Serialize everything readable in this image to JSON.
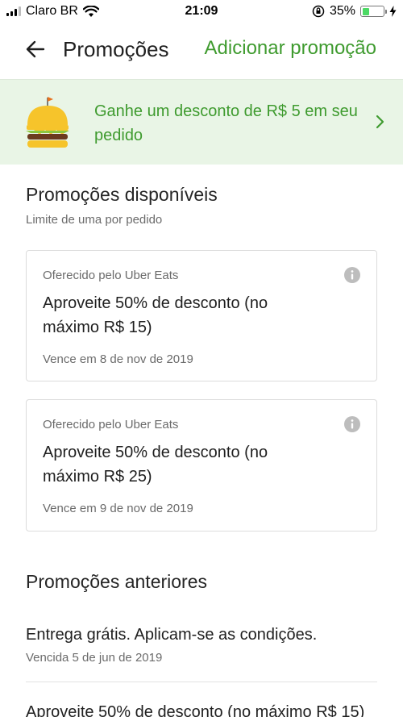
{
  "status_bar": {
    "carrier": "Claro BR",
    "time": "21:09",
    "battery": "35%",
    "battery_level": 0.35
  },
  "header": {
    "title": "Promoções",
    "add_promo": "Adicionar promoção"
  },
  "banner": {
    "text": "Ganhe um desconto de R$ 5 em seu pedido"
  },
  "available": {
    "title": "Promoções disponíveis",
    "subtitle": "Limite de uma por pedido",
    "cards": [
      {
        "offered_by": "Oferecido pelo Uber Eats",
        "title": "Aproveite 50% de desconto (no máximo R$ 15)",
        "expiry": "Vence em 8 de nov de 2019"
      },
      {
        "offered_by": "Oferecido pelo Uber Eats",
        "title": "Aproveite 50% de desconto (no máximo R$ 25)",
        "expiry": "Vence em 9 de nov de 2019"
      }
    ]
  },
  "previous": {
    "title": "Promoções anteriores",
    "items": [
      {
        "title": "Entrega grátis. Aplicam-se as condições.",
        "sub": "Vencida 5 de jun de 2019"
      },
      {
        "title": "Aproveite 50% de desconto (no máximo R$ 15)"
      }
    ]
  },
  "colors": {
    "accent_green": "#3f9b2f",
    "banner_bg": "#e9f5e6"
  },
  "icons": [
    "signal-icon",
    "wifi-icon",
    "rotation-lock-icon",
    "battery-icon",
    "charging-icon",
    "back-arrow-icon",
    "burger-icon",
    "chevron-right-icon",
    "info-icon"
  ]
}
